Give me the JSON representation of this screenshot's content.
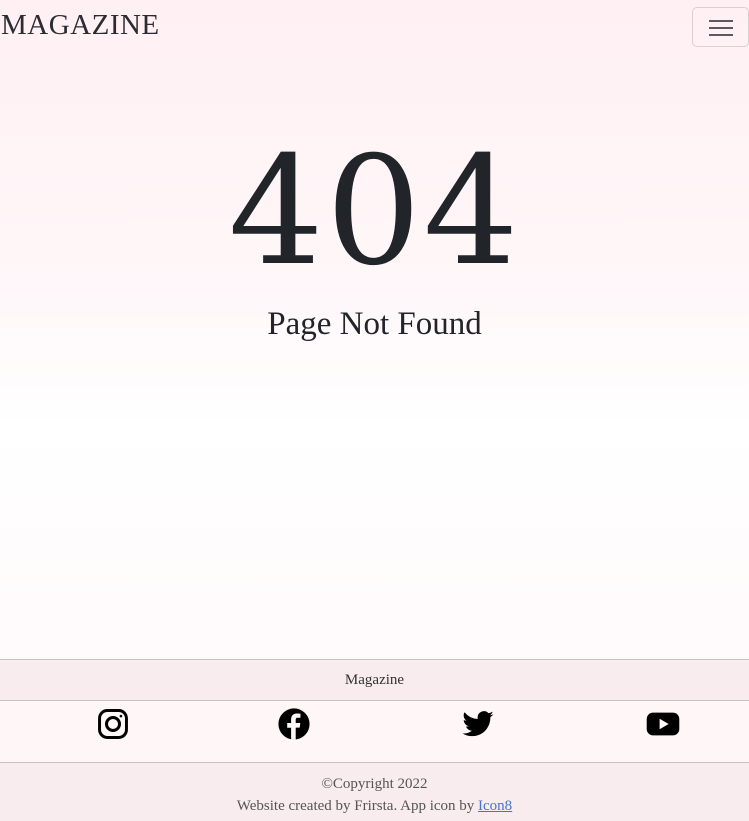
{
  "navbar": {
    "brand": "MAGAZINE",
    "toggler_icon": "hamburger-menu-icon"
  },
  "main": {
    "error_code": "404",
    "error_message": "Page Not Found"
  },
  "footer": {
    "site_name": "Magazine",
    "social": [
      {
        "name": "instagram-icon"
      },
      {
        "name": "facebook-icon"
      },
      {
        "name": "twitter-icon"
      },
      {
        "name": "youtube-icon"
      }
    ],
    "copyright": "©Copyright 2022",
    "credit_text": "Website created by Frirsta. App icon by",
    "credit_link": "Icon8"
  },
  "colors": {
    "text": "#212529",
    "footer_bg": "#f8ecef",
    "link": "#4c6fd6"
  }
}
